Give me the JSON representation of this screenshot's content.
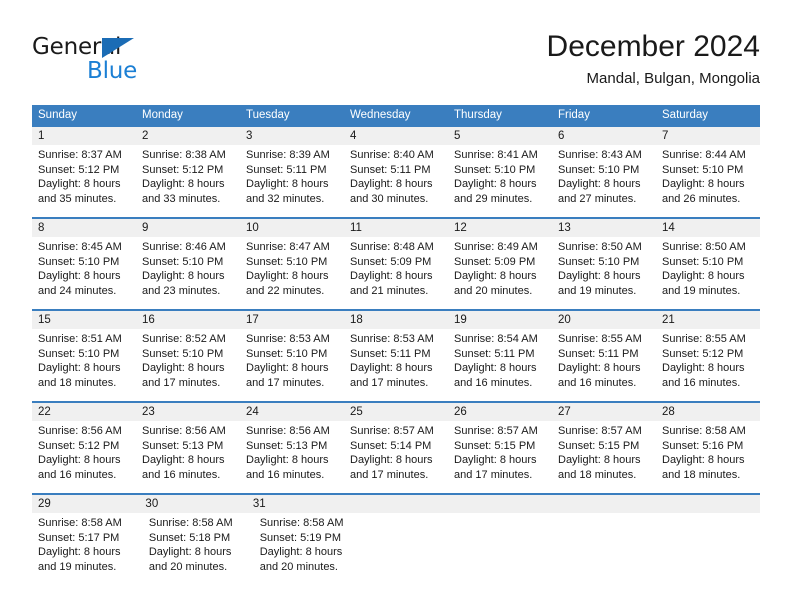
{
  "brand": {
    "name_part1": "General",
    "name_part2": "Blue",
    "triangle_color": "#1b6cb5",
    "blue_color": "#1b7fd4"
  },
  "header": {
    "title": "December 2024",
    "location": "Mandal, Bulgan, Mongolia"
  },
  "theme": {
    "header_bg": "#3a7ebf",
    "daynum_bg": "#f0f0f0",
    "text": "#1a1a1a"
  },
  "weekdays": [
    "Sunday",
    "Monday",
    "Tuesday",
    "Wednesday",
    "Thursday",
    "Friday",
    "Saturday"
  ],
  "weeks": [
    {
      "days": [
        {
          "num": "1",
          "sunrise": "Sunrise: 8:37 AM",
          "sunset": "Sunset: 5:12 PM",
          "daylight1": "Daylight: 8 hours",
          "daylight2": "and 35 minutes."
        },
        {
          "num": "2",
          "sunrise": "Sunrise: 8:38 AM",
          "sunset": "Sunset: 5:12 PM",
          "daylight1": "Daylight: 8 hours",
          "daylight2": "and 33 minutes."
        },
        {
          "num": "3",
          "sunrise": "Sunrise: 8:39 AM",
          "sunset": "Sunset: 5:11 PM",
          "daylight1": "Daylight: 8 hours",
          "daylight2": "and 32 minutes."
        },
        {
          "num": "4",
          "sunrise": "Sunrise: 8:40 AM",
          "sunset": "Sunset: 5:11 PM",
          "daylight1": "Daylight: 8 hours",
          "daylight2": "and 30 minutes."
        },
        {
          "num": "5",
          "sunrise": "Sunrise: 8:41 AM",
          "sunset": "Sunset: 5:10 PM",
          "daylight1": "Daylight: 8 hours",
          "daylight2": "and 29 minutes."
        },
        {
          "num": "6",
          "sunrise": "Sunrise: 8:43 AM",
          "sunset": "Sunset: 5:10 PM",
          "daylight1": "Daylight: 8 hours",
          "daylight2": "and 27 minutes."
        },
        {
          "num": "7",
          "sunrise": "Sunrise: 8:44 AM",
          "sunset": "Sunset: 5:10 PM",
          "daylight1": "Daylight: 8 hours",
          "daylight2": "and 26 minutes."
        }
      ]
    },
    {
      "days": [
        {
          "num": "8",
          "sunrise": "Sunrise: 8:45 AM",
          "sunset": "Sunset: 5:10 PM",
          "daylight1": "Daylight: 8 hours",
          "daylight2": "and 24 minutes."
        },
        {
          "num": "9",
          "sunrise": "Sunrise: 8:46 AM",
          "sunset": "Sunset: 5:10 PM",
          "daylight1": "Daylight: 8 hours",
          "daylight2": "and 23 minutes."
        },
        {
          "num": "10",
          "sunrise": "Sunrise: 8:47 AM",
          "sunset": "Sunset: 5:10 PM",
          "daylight1": "Daylight: 8 hours",
          "daylight2": "and 22 minutes."
        },
        {
          "num": "11",
          "sunrise": "Sunrise: 8:48 AM",
          "sunset": "Sunset: 5:09 PM",
          "daylight1": "Daylight: 8 hours",
          "daylight2": "and 21 minutes."
        },
        {
          "num": "12",
          "sunrise": "Sunrise: 8:49 AM",
          "sunset": "Sunset: 5:09 PM",
          "daylight1": "Daylight: 8 hours",
          "daylight2": "and 20 minutes."
        },
        {
          "num": "13",
          "sunrise": "Sunrise: 8:50 AM",
          "sunset": "Sunset: 5:10 PM",
          "daylight1": "Daylight: 8 hours",
          "daylight2": "and 19 minutes."
        },
        {
          "num": "14",
          "sunrise": "Sunrise: 8:50 AM",
          "sunset": "Sunset: 5:10 PM",
          "daylight1": "Daylight: 8 hours",
          "daylight2": "and 19 minutes."
        }
      ]
    },
    {
      "days": [
        {
          "num": "15",
          "sunrise": "Sunrise: 8:51 AM",
          "sunset": "Sunset: 5:10 PM",
          "daylight1": "Daylight: 8 hours",
          "daylight2": "and 18 minutes."
        },
        {
          "num": "16",
          "sunrise": "Sunrise: 8:52 AM",
          "sunset": "Sunset: 5:10 PM",
          "daylight1": "Daylight: 8 hours",
          "daylight2": "and 17 minutes."
        },
        {
          "num": "17",
          "sunrise": "Sunrise: 8:53 AM",
          "sunset": "Sunset: 5:10 PM",
          "daylight1": "Daylight: 8 hours",
          "daylight2": "and 17 minutes."
        },
        {
          "num": "18",
          "sunrise": "Sunrise: 8:53 AM",
          "sunset": "Sunset: 5:11 PM",
          "daylight1": "Daylight: 8 hours",
          "daylight2": "and 17 minutes."
        },
        {
          "num": "19",
          "sunrise": "Sunrise: 8:54 AM",
          "sunset": "Sunset: 5:11 PM",
          "daylight1": "Daylight: 8 hours",
          "daylight2": "and 16 minutes."
        },
        {
          "num": "20",
          "sunrise": "Sunrise: 8:55 AM",
          "sunset": "Sunset: 5:11 PM",
          "daylight1": "Daylight: 8 hours",
          "daylight2": "and 16 minutes."
        },
        {
          "num": "21",
          "sunrise": "Sunrise: 8:55 AM",
          "sunset": "Sunset: 5:12 PM",
          "daylight1": "Daylight: 8 hours",
          "daylight2": "and 16 minutes."
        }
      ]
    },
    {
      "days": [
        {
          "num": "22",
          "sunrise": "Sunrise: 8:56 AM",
          "sunset": "Sunset: 5:12 PM",
          "daylight1": "Daylight: 8 hours",
          "daylight2": "and 16 minutes."
        },
        {
          "num": "23",
          "sunrise": "Sunrise: 8:56 AM",
          "sunset": "Sunset: 5:13 PM",
          "daylight1": "Daylight: 8 hours",
          "daylight2": "and 16 minutes."
        },
        {
          "num": "24",
          "sunrise": "Sunrise: 8:56 AM",
          "sunset": "Sunset: 5:13 PM",
          "daylight1": "Daylight: 8 hours",
          "daylight2": "and 16 minutes."
        },
        {
          "num": "25",
          "sunrise": "Sunrise: 8:57 AM",
          "sunset": "Sunset: 5:14 PM",
          "daylight1": "Daylight: 8 hours",
          "daylight2": "and 17 minutes."
        },
        {
          "num": "26",
          "sunrise": "Sunrise: 8:57 AM",
          "sunset": "Sunset: 5:15 PM",
          "daylight1": "Daylight: 8 hours",
          "daylight2": "and 17 minutes."
        },
        {
          "num": "27",
          "sunrise": "Sunrise: 8:57 AM",
          "sunset": "Sunset: 5:15 PM",
          "daylight1": "Daylight: 8 hours",
          "daylight2": "and 18 minutes."
        },
        {
          "num": "28",
          "sunrise": "Sunrise: 8:58 AM",
          "sunset": "Sunset: 5:16 PM",
          "daylight1": "Daylight: 8 hours",
          "daylight2": "and 18 minutes."
        }
      ]
    },
    {
      "days": [
        {
          "num": "29",
          "sunrise": "Sunrise: 8:58 AM",
          "sunset": "Sunset: 5:17 PM",
          "daylight1": "Daylight: 8 hours",
          "daylight2": "and 19 minutes."
        },
        {
          "num": "30",
          "sunrise": "Sunrise: 8:58 AM",
          "sunset": "Sunset: 5:18 PM",
          "daylight1": "Daylight: 8 hours",
          "daylight2": "and 20 minutes."
        },
        {
          "num": "31",
          "sunrise": "Sunrise: 8:58 AM",
          "sunset": "Sunset: 5:19 PM",
          "daylight1": "Daylight: 8 hours",
          "daylight2": "and 20 minutes."
        }
      ]
    }
  ]
}
